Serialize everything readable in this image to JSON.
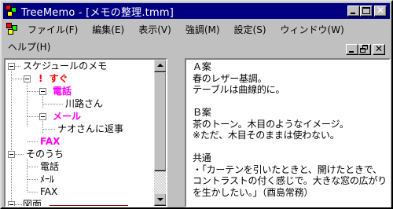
{
  "window": {
    "title": "TreeMemo - [メモの整理.tmm]"
  },
  "menu": {
    "row1": [
      "ファイル(F)",
      "編集(E)",
      "表示(V)",
      "強調(M)",
      "設定(S)",
      "ウィンドウ(W)"
    ],
    "row2": [
      "ヘルプ(H)"
    ]
  },
  "tree": {
    "nodes": [
      {
        "label": "スケジュールのメモ",
        "style": "normal"
      },
      {
        "label": "すぐ",
        "prefix": "!",
        "style": "red"
      },
      {
        "label": "電話",
        "style": "pink"
      },
      {
        "label": "川路さん",
        "style": "normal"
      },
      {
        "label": "メール",
        "style": "pink"
      },
      {
        "label": "ナオさんに返事",
        "style": "normal"
      },
      {
        "label": "FAX",
        "style": "pink"
      },
      {
        "label": "そのうち",
        "style": "normal"
      },
      {
        "label": "電話",
        "style": "normal"
      },
      {
        "label": "ﾒｰﾙ",
        "style": "normal"
      },
      {
        "label": "FAX",
        "style": "normal"
      },
      {
        "label": "図面",
        "style": "normal"
      }
    ]
  },
  "memo": {
    "text": "Ａ案\n春のレザー基調。\nテーブルは曲線的に。\n\nＢ案\n茶のトーン。木目のようなイメージ。\n※ただ、木目そのままは使わない。\n\n共通\n・「カーテンを引いたときと、開けたときで、コントラストの付く感じで。大きな窓の広がりを生かしたい。」（酉島常務）"
  },
  "colors": {
    "titlebar": "#000080",
    "highlight_pink": "#ff00ff",
    "highlight_red": "#ff0000"
  }
}
